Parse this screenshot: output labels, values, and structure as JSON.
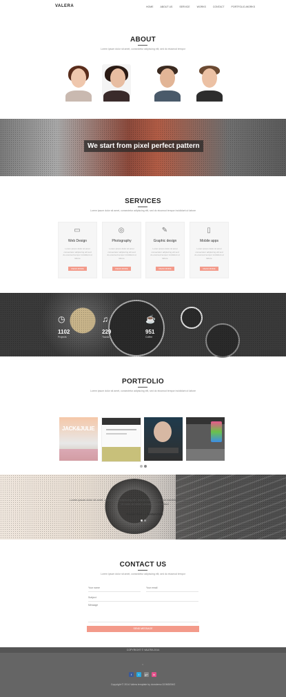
{
  "nav": {
    "logo": "VALERA",
    "items": [
      "HOME",
      "ABOUT US",
      "SERVICE",
      "WORKS",
      "CONTACT",
      "PORTFOLIO-WORKS"
    ]
  },
  "about": {
    "title": "ABOUT",
    "subtitle": "Lorem ipsum dolor sit amet, consectetur adipiscing elit, sed do eiusmod tempor"
  },
  "banner": {
    "tagline": "We start from pixel perfect pattern"
  },
  "services": {
    "title": "SERVICES",
    "subtitle": "Lorem ipsum dolor sit amet, consectetur adipiscing elit, sed do eiusmod tempor incididunt ut labore",
    "cards": [
      {
        "title": "Web Design",
        "icon": "monitor-icon",
        "text": "Lorem ipsum dolor sit amet consectetur adipiscing elit sed do eiusmod tempor incididunt ut labore",
        "button": "READ MORE"
      },
      {
        "title": "Photography",
        "icon": "camera-icon",
        "text": "Lorem ipsum dolor sit amet consectetur adipiscing elit sed do eiusmod tempor incididunt ut labore",
        "button": "READ MORE"
      },
      {
        "title": "Graphic design",
        "icon": "pen-icon",
        "text": "Lorem ipsum dolor sit amet consectetur adipiscing elit sed do eiusmod tempor incididunt ut labore",
        "button": "READ MORE"
      },
      {
        "title": "Mobile apps",
        "icon": "phone-icon",
        "text": "Lorem ipsum dolor sit amet consectetur adipiscing elit sed do eiusmod tempor incididunt ut labore",
        "button": "READ MORE"
      }
    ]
  },
  "stats": [
    {
      "value": "1102",
      "label": "Projects",
      "icon": "clock-icon"
    },
    {
      "value": "229",
      "label": "Tracks",
      "icon": "music-icon"
    },
    {
      "value": "951",
      "label": "Coffee",
      "icon": "coffee-icon"
    }
  ],
  "portfolio": {
    "title": "PORTFOLIO",
    "subtitle": "Lorem ipsum dolor sit amet, consectetur adipiscing elit, sed do eiusmod tempor incididunt ut labore",
    "thumb1_text": "JACK&JULIE"
  },
  "testimonial": {
    "quote": "Lorem ipsum dolor sit amet, consectetur adipiscing elit, sed do eiusmod tempor incididunt ut labore et dolore magna aliqua. Ut enim ad minim veniam, quis nostrud",
    "author": "Daniel Dan — MANAGER"
  },
  "contact": {
    "title": "CONTACT US",
    "subtitle": "Lorem ipsum dolor sit amet, consectetur adipiscing elit, sed do eiusmod tempor",
    "name_placeholder": "Your name",
    "email_placeholder": "Your email",
    "subject_placeholder": "Subject",
    "message_placeholder": "Message",
    "submit": "SEND MESSAGE"
  },
  "footer": {
    "top_text": "COPYRIGHT © VALERA 2014",
    "copyright": "Copyright © 2014 Valera template by domdemo DOMDEMO",
    "social": [
      "f",
      "t",
      "g+",
      "in"
    ]
  },
  "colors": {
    "accent": "#f39a8a",
    "facebook": "#3b5998",
    "twitter": "#29a9e1",
    "google": "#888888",
    "dribbble": "#e4508a"
  }
}
